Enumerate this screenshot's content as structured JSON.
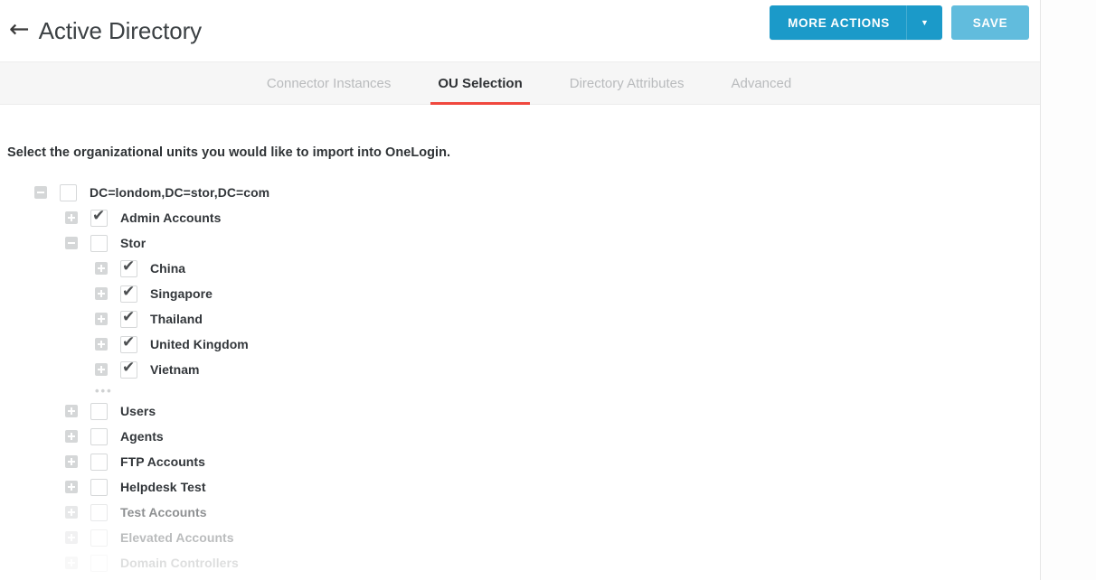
{
  "header": {
    "back_icon": "←",
    "title": "Active Directory",
    "more_actions_label": "MORE ACTIONS",
    "caret_icon": "▼",
    "save_label": "SAVE"
  },
  "tabs": [
    {
      "label": "Connector Instances",
      "active": false
    },
    {
      "label": "OU Selection",
      "active": true
    },
    {
      "label": "Directory Attributes",
      "active": false
    },
    {
      "label": "Advanced",
      "active": false
    }
  ],
  "main": {
    "instruction": "Select the organizational units you would like to import into OneLogin.",
    "ellipsis": "•••"
  },
  "tree": [
    {
      "label": "DC=londom,DC=stor,DC=com",
      "level": 0,
      "expander": "minus",
      "checked": false,
      "fade": 0
    },
    {
      "label": "Admin Accounts",
      "level": 1,
      "expander": "plus",
      "checked": true,
      "fade": 0
    },
    {
      "label": "Stor",
      "level": 1,
      "expander": "minus",
      "checked": false,
      "fade": 0
    },
    {
      "label": "China",
      "level": 2,
      "expander": "plus",
      "checked": true,
      "fade": 0
    },
    {
      "label": "Singapore",
      "level": 2,
      "expander": "plus",
      "checked": true,
      "fade": 0
    },
    {
      "label": "Thailand",
      "level": 2,
      "expander": "plus",
      "checked": true,
      "fade": 0
    },
    {
      "label": "United Kingdom",
      "level": 2,
      "expander": "plus",
      "checked": true,
      "fade": 0
    },
    {
      "label": "Vietnam",
      "level": 2,
      "expander": "plus",
      "checked": true,
      "fade": 0
    },
    {
      "label": "Users",
      "level": 1,
      "expander": "plus",
      "checked": false,
      "fade": 0
    },
    {
      "label": "Agents",
      "level": 1,
      "expander": "plus",
      "checked": false,
      "fade": 0
    },
    {
      "label": "FTP Accounts",
      "level": 1,
      "expander": "plus",
      "checked": false,
      "fade": 0
    },
    {
      "label": "Helpdesk Test",
      "level": 1,
      "expander": "plus",
      "checked": false,
      "fade": 0
    },
    {
      "label": "Test Accounts",
      "level": 1,
      "expander": "plus",
      "checked": false,
      "fade": 1
    },
    {
      "label": "Elevated Accounts",
      "level": 1,
      "expander": "plus",
      "checked": false,
      "fade": 2
    },
    {
      "label": "Domain Controllers",
      "level": 1,
      "expander": "plus",
      "checked": false,
      "fade": 3
    }
  ],
  "colors": {
    "primary_blue": "#1b9ac9",
    "disabled_blue": "#61bcdd",
    "active_tab_underline": "#f0483e",
    "tabbar_bg": "#f6f6f6"
  }
}
